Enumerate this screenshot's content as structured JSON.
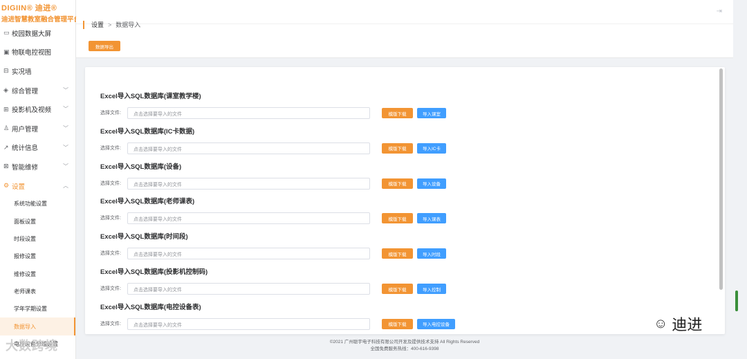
{
  "brand": {
    "logo": "DIGIIN® 迪进®",
    "subtitle": "迪进智慧教室融合管理平台"
  },
  "sidebar": {
    "items": [
      {
        "label": "校园数据大屏",
        "icon": "monitor-icon",
        "glyph": "▭",
        "chevron": ""
      },
      {
        "label": "物联电控视图",
        "icon": "display-icon",
        "glyph": "▣",
        "chevron": ""
      },
      {
        "label": "实况墙",
        "icon": "video-wall-icon",
        "glyph": "⊟",
        "chevron": ""
      },
      {
        "label": "综合管理",
        "icon": "layers-icon",
        "glyph": "◈",
        "chevron": "﹀"
      },
      {
        "label": "投影机及视频",
        "icon": "projector-icon",
        "glyph": "⊞",
        "chevron": "﹀"
      },
      {
        "label": "用户管理",
        "icon": "user-icon",
        "glyph": "♙",
        "chevron": "﹀"
      },
      {
        "label": "统计信息",
        "icon": "chart-icon",
        "glyph": "↗",
        "chevron": "﹀"
      },
      {
        "label": "智能维修",
        "icon": "repair-icon",
        "glyph": "⊠",
        "chevron": "﹀"
      },
      {
        "label": "设置",
        "icon": "gear-icon",
        "glyph": "⚙",
        "chevron": "︿"
      }
    ],
    "subitems": [
      "系统功能设置",
      "面板设置",
      "时段设置",
      "报修设置",
      "维修设置",
      "老师课表",
      "学年学期设置",
      "数据导入",
      "电控设备分组设置"
    ]
  },
  "breadcrumb": {
    "root": "设置",
    "sep": ">",
    "current": "数据导入"
  },
  "toolbar": {
    "export_label": "数据导出"
  },
  "sections": [
    {
      "title": "Excel导入SQL数据库(课室教学楼)",
      "label": "选择文件:",
      "placeholder": "点击选择要导入的文件",
      "template": "模版下载",
      "import": "导入课室"
    },
    {
      "title": "Excel导入SQL数据库(IC卡数据)",
      "label": "选择文件:",
      "placeholder": "点击选择要导入的文件",
      "template": "模版下载",
      "import": "导入IC卡"
    },
    {
      "title": "Excel导入SQL数据库(设备)",
      "label": "选择文件:",
      "placeholder": "点击选择要导入的文件",
      "template": "模版下载",
      "import": "导入设备"
    },
    {
      "title": "Excel导入SQL数据库(老师课表)",
      "label": "选择文件:",
      "placeholder": "点击选择要导入的文件",
      "template": "模版下载",
      "import": "导入课表"
    },
    {
      "title": "Excel导入SQL数据库(时间段)",
      "label": "选择文件:",
      "placeholder": "点击选择要导入的文件",
      "template": "模版下载",
      "import": "导入时段"
    },
    {
      "title": "Excel导入SQL数据库(投影机控制码)",
      "label": "选择文件:",
      "placeholder": "点击选择要导入的文件",
      "template": "模版下载",
      "import": "导入控制"
    },
    {
      "title": "Excel导入SQL数据库(电控设备表)",
      "label": "选择文件:",
      "placeholder": "点击选择要导入的文件",
      "template": "模版下载",
      "import": "导入电控设备"
    }
  ],
  "footer": {
    "line1": "©2021 广州聪宇电子科技有限公司开发及提供技术支持 All Rights Reserved",
    "line2": "全国免费服务热线：400-616-9398"
  },
  "watermarks": {
    "left": "大数跨境",
    "right": "迪进"
  },
  "colors": {
    "accent": "#f29433",
    "primary": "#409eff"
  }
}
